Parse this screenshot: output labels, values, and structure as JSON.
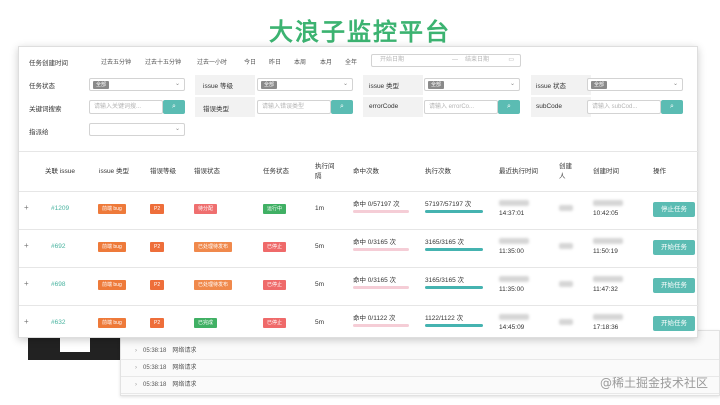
{
  "slide_title": "大浪子监控平台",
  "watermark": "@稀土掘金技术社区",
  "filters": {
    "created_label": "任务创建时间",
    "quick_ranges": [
      "过去五分钟",
      "过去十五分钟",
      "过去一小时",
      "今日",
      "昨日",
      "本周",
      "本月",
      "全年"
    ],
    "date_start_placeholder": "开始日期",
    "date_sep": "—",
    "date_end_placeholder": "结束日期",
    "task_status_label": "任务状态",
    "task_status_value": "全部",
    "issue_level_label": "issue 等级",
    "issue_level_value": "全部",
    "issue_type_label": "issue 类型",
    "issue_type_value": "全部",
    "issue_status_label": "issue 状态",
    "issue_status_value": "全部",
    "keyword_label": "关键词搜索",
    "keyword_placeholder": "请输入关键词搜...",
    "error_type_label": "错误类型",
    "error_type_placeholder": "请输入错误类型",
    "errorcode_label": "errorCode",
    "errorcode_placeholder": "请输入 errorCo...",
    "subcode_label": "subCode",
    "subcode_placeholder": "请输入 subCod...",
    "assignee_label": "指派给"
  },
  "columns": [
    "关联 issue",
    "issue 类型",
    "错误等级",
    "错误状态",
    "任务状态",
    "执行间隔",
    "命中次数",
    "执行次数",
    "最近执行时间",
    "创建人",
    "创建时间",
    "操作"
  ],
  "rows": [
    {
      "expand": "+",
      "issue": "#1209",
      "type": "前端 bug",
      "level": "P2",
      "err_status": "待分配",
      "task_status": "运行中",
      "interval": "1m",
      "hits": "命中 0/57197 次",
      "execs": "57197/57197 次",
      "last_exec": "14:37:01",
      "created": "10:42:05",
      "action": "停止任务"
    },
    {
      "expand": "+",
      "issue": "#692",
      "type": "前端 bug",
      "level": "P2",
      "err_status": "已处理待发布",
      "task_status": "已停止",
      "interval": "5m",
      "hits": "命中 0/3165 次",
      "execs": "3165/3165 次",
      "last_exec": "11:35:00",
      "created": "11:50:19",
      "action": "开始任务"
    },
    {
      "expand": "+",
      "issue": "#698",
      "type": "前端 bug",
      "level": "P2",
      "err_status": "已处理待发布",
      "task_status": "已停止",
      "interval": "5m",
      "hits": "命中 0/3165 次",
      "execs": "3165/3165 次",
      "last_exec": "11:35:00",
      "created": "11:47:32",
      "action": "开始任务"
    },
    {
      "expand": "+",
      "issue": "#632",
      "type": "前端 bug",
      "level": "P2",
      "err_status": "已完成",
      "task_status": "已停止",
      "interval": "5m",
      "hits": "命中 0/1122 次",
      "execs": "1122/1122 次",
      "last_exec": "14:45:09",
      "created": "17:18:36",
      "action": "开始任务"
    }
  ],
  "background_logs": [
    {
      "time": "05:38:18",
      "label": "网络请求"
    },
    {
      "time": "05:38:18",
      "label": "网络请求"
    },
    {
      "time": "05:38:18",
      "label": "网络请求"
    }
  ],
  "colors": {
    "accent": "#5bbcb3",
    "title_green": "#3cb371",
    "link": "#48b39f",
    "danger": "#ef6a6a",
    "success": "#40b064"
  }
}
